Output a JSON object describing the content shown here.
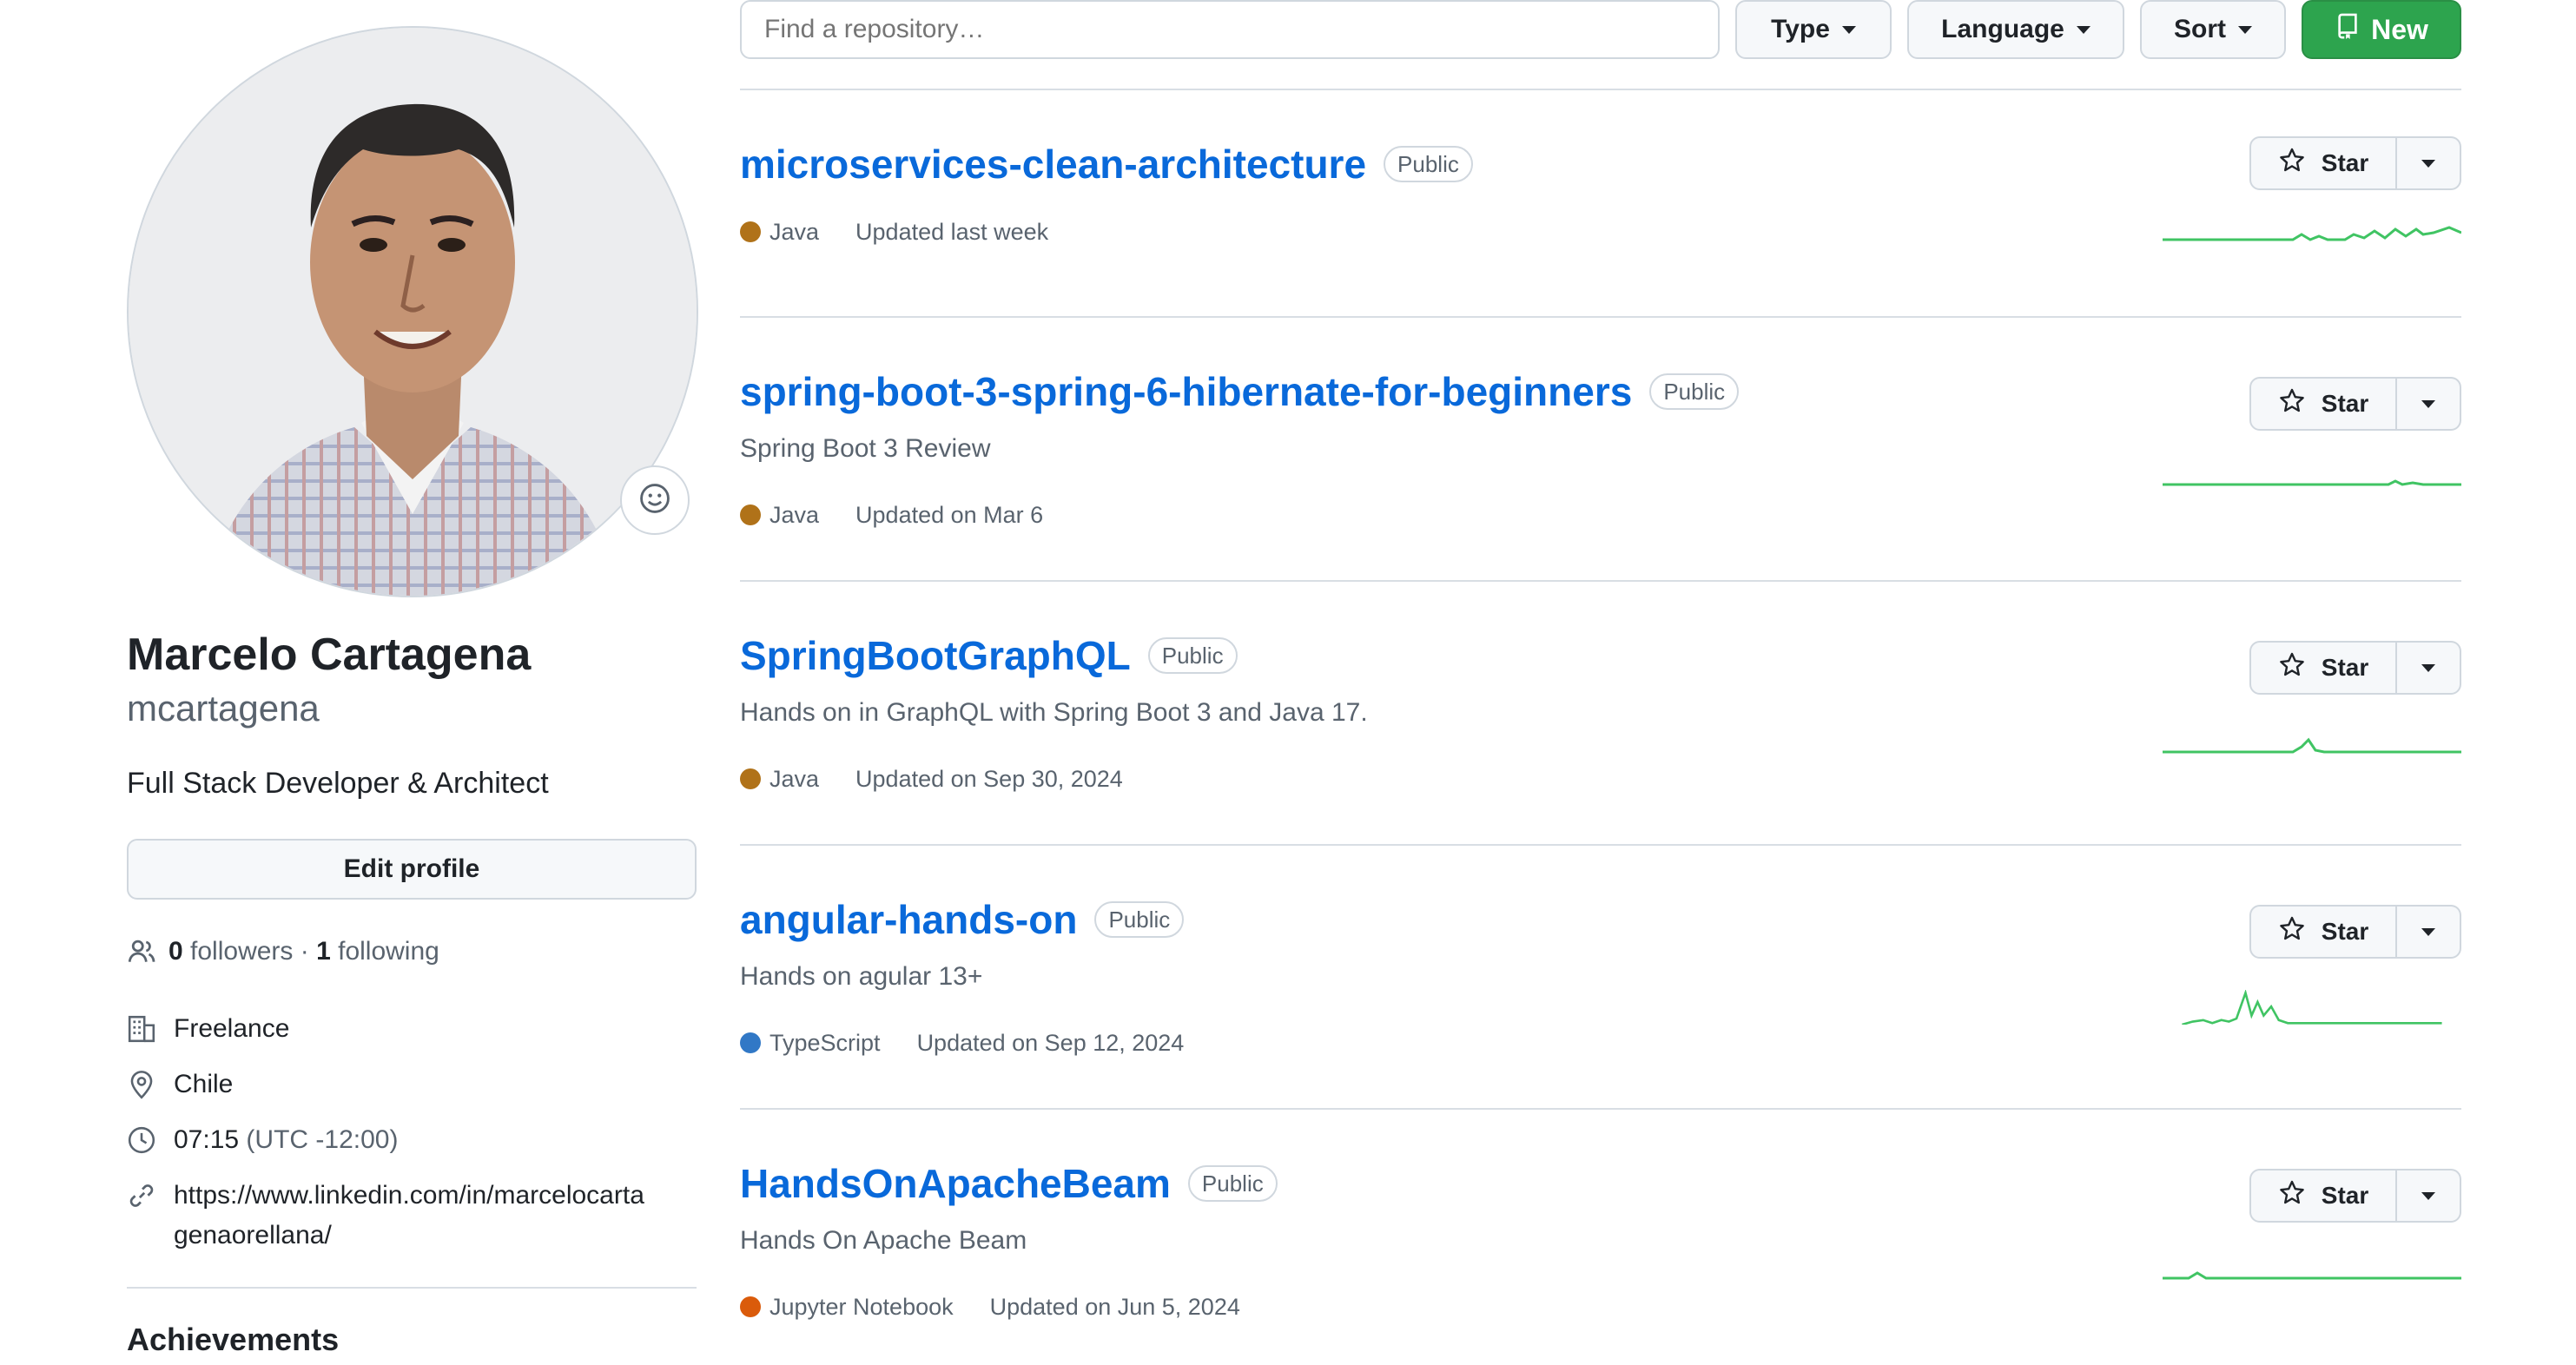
{
  "profile": {
    "full_name": "Marcelo Cartagena",
    "username": "mcartagena",
    "bio": "Full Stack Developer & Architect",
    "edit_label": "Edit profile",
    "followers_count": "0",
    "followers_label": "followers",
    "separator": " · ",
    "following_count": "1",
    "following_label": "following",
    "company": "Freelance",
    "location": "Chile",
    "local_time": "07:15",
    "timezone": "(UTC -12:00)",
    "website_line1": "https://www.linkedin.com/in/marcelocarta",
    "website_line2": "genaorellana/",
    "achievements_heading": "Achievements"
  },
  "toolbar": {
    "search_placeholder": "Find a repository…",
    "type_label": "Type",
    "language_label": "Language",
    "sort_label": "Sort",
    "new_label": "New",
    "new_button_color": "#2da44e"
  },
  "repos": [
    {
      "name": "microservices-clean-architecture",
      "visibility": "Public",
      "description": "",
      "language": "Java",
      "language_color": "#b07219",
      "updated": "Updated last week",
      "star_label": "Star"
    },
    {
      "name": "spring-boot-3-spring-6-hibernate-for-beginners",
      "visibility": "Public",
      "description": "Spring Boot 3 Review",
      "language": "Java",
      "language_color": "#b07219",
      "updated": "Updated on Mar 6",
      "star_label": "Star"
    },
    {
      "name": "SpringBootGraphQL",
      "visibility": "Public",
      "description": "Hands on in GraphQL with Spring Boot 3 and Java 17.",
      "language": "Java",
      "language_color": "#b07219",
      "updated": "Updated on Sep 30, 2024",
      "star_label": "Star"
    },
    {
      "name": "angular-hands-on",
      "visibility": "Public",
      "description": "Hands on agular 13+",
      "language": "TypeScript",
      "language_color": "#3178c6",
      "updated": "Updated on Sep 12, 2024",
      "star_label": "Star"
    },
    {
      "name": "HandsOnApacheBeam",
      "visibility": "Public",
      "description": "Hands On Apache Beam",
      "language": "Jupyter Notebook",
      "language_color": "#da5b0b",
      "updated": "Updated on Jun 5, 2024",
      "star_label": "Star"
    }
  ],
  "colors": {
    "link": "#0969da",
    "sparkline": "#40c463"
  }
}
